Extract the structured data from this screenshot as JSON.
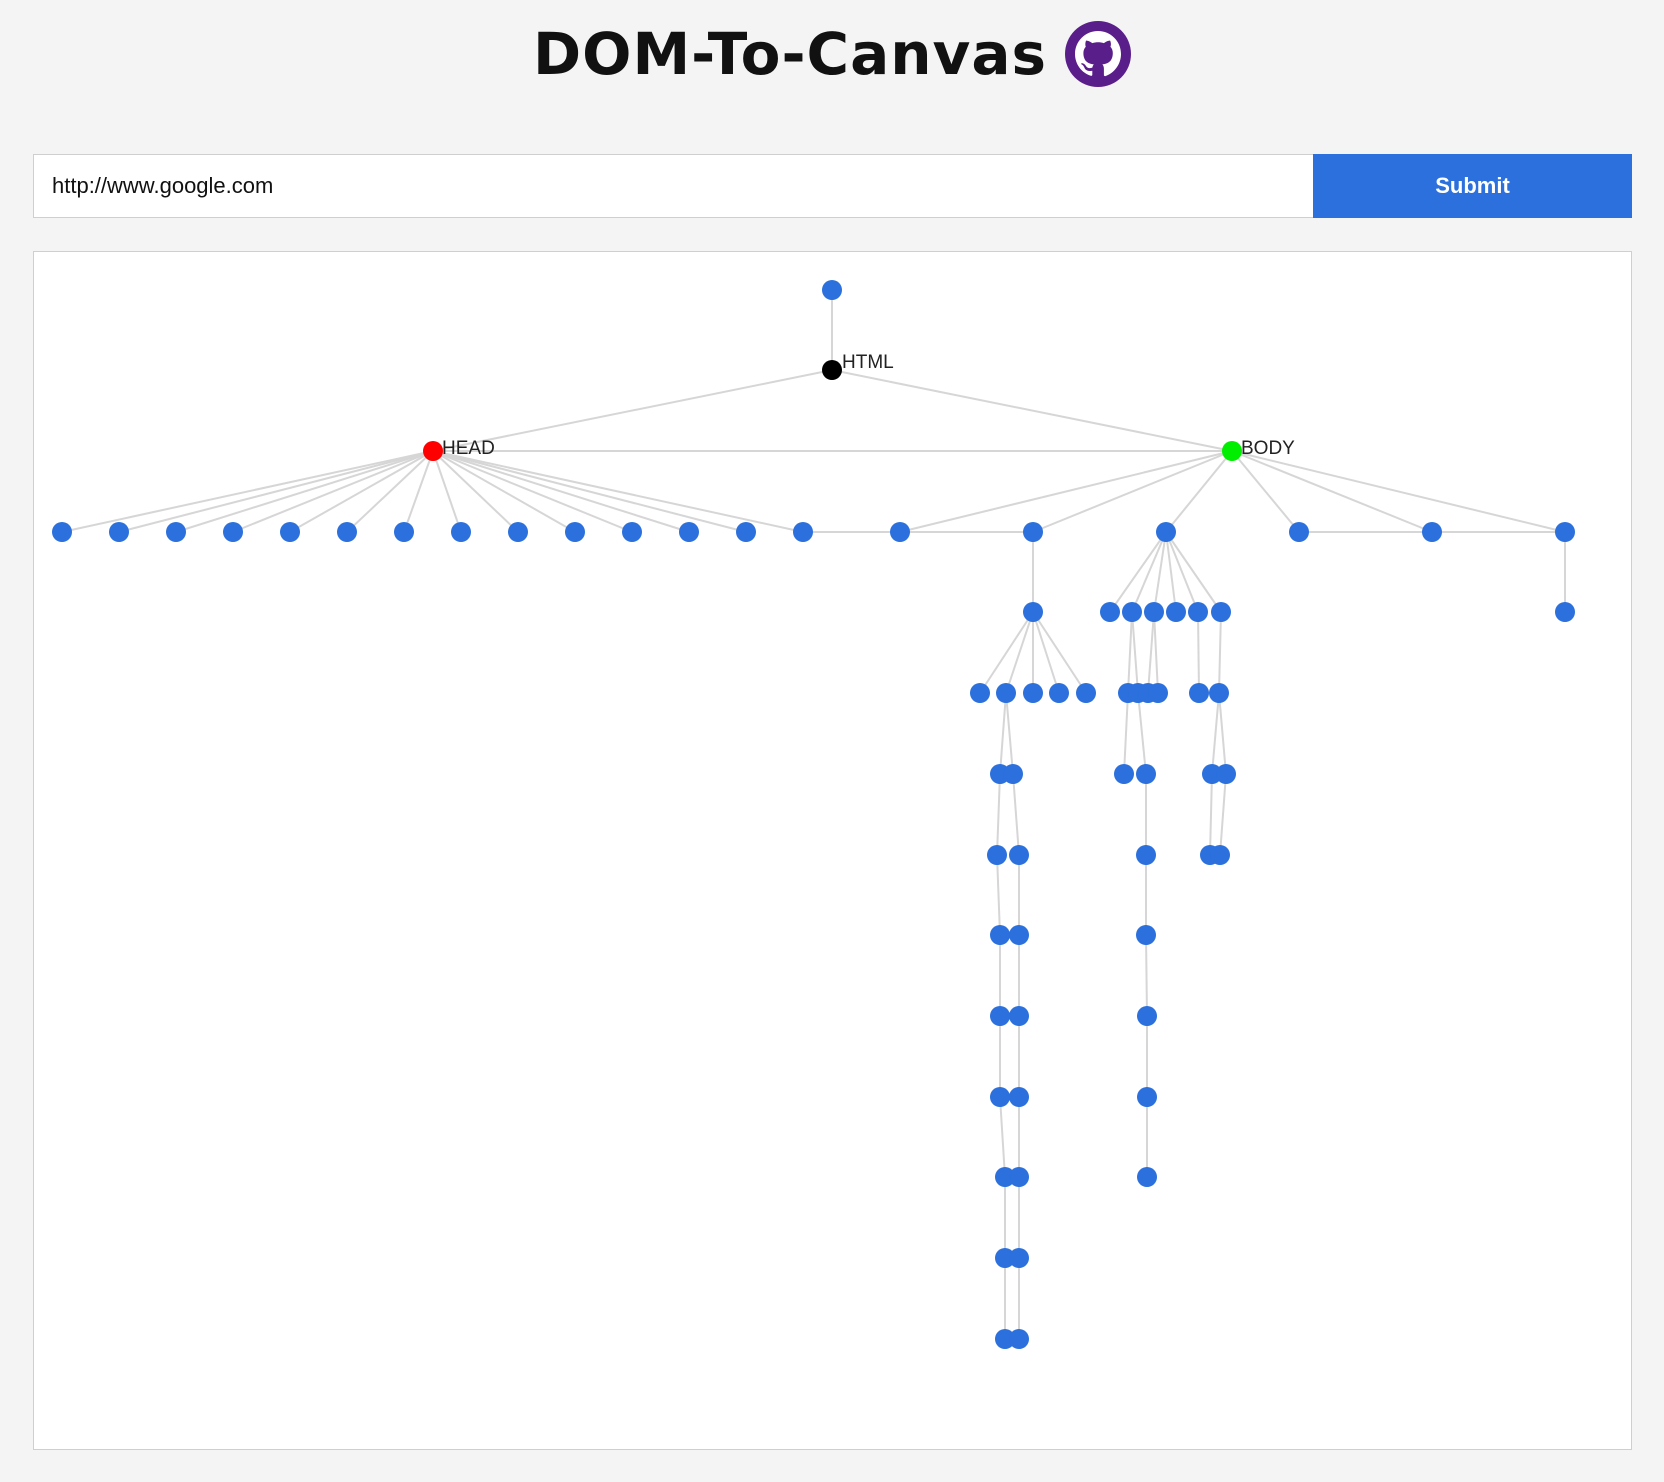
{
  "header": {
    "title": "DOM-To-Canvas",
    "github_icon": "github-icon",
    "github_color": "#5a1e8a"
  },
  "form": {
    "url_value": "http://www.google.com",
    "submit_label": "Submit"
  },
  "colors": {
    "node": "#2b70dc",
    "html_node": "#000000",
    "head_node": "#ff0000",
    "body_node": "#00ee00",
    "edge": "#d6d6d6",
    "submit": "#2b70dc"
  },
  "tree": {
    "labels": {
      "html": "HTML",
      "head": "HEAD",
      "body": "BODY"
    },
    "head_children": 14,
    "body_children": 6
  }
}
